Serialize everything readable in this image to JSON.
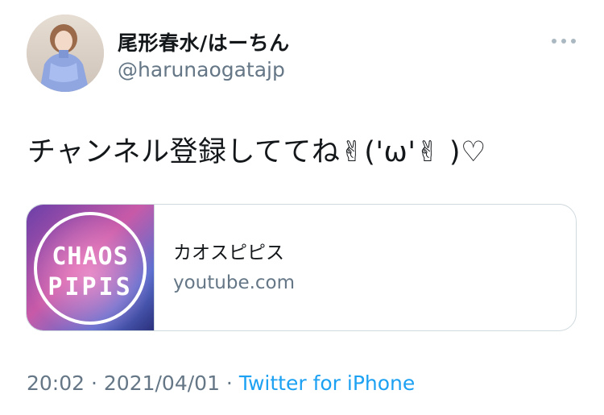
{
  "tweet": {
    "author": {
      "display_name": "尾形春水/はーちん",
      "handle": "@harunaogatajp",
      "avatar_icon": "user-avatar-photo"
    },
    "more_icon": "more-options-icon",
    "text": "チャンネル登録しててね✌︎('ω'✌︎ )♡",
    "card": {
      "thumbnail_line1": "CHAOS",
      "thumbnail_line2": "PIPIS",
      "title": "カオスピピス",
      "domain": "youtube.com"
    },
    "meta": {
      "time": "20:02",
      "separator1": " · ",
      "date": "2021/04/01",
      "separator2": " · ",
      "source": "Twitter for iPhone"
    }
  },
  "colors": {
    "text_primary": "#14171a",
    "text_secondary": "#657786",
    "link_blue": "#1da1f2",
    "border": "#cfd9de"
  }
}
